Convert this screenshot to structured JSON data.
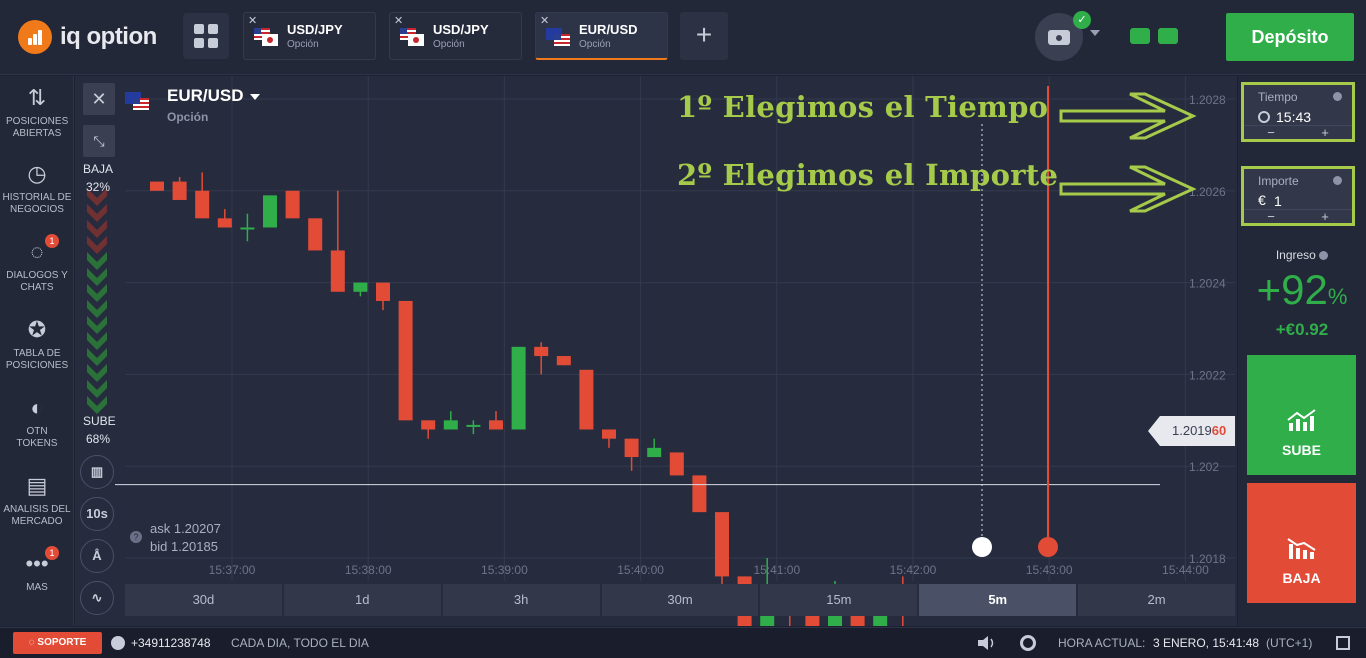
{
  "app": {
    "logo_text": "iq option",
    "deposit_label": "Depósito"
  },
  "tabs": [
    {
      "name": "USD/JPY",
      "type": "Opción",
      "flags": [
        "us",
        "jp"
      ]
    },
    {
      "name": "USD/JPY",
      "type": "Opción",
      "flags": [
        "us",
        "jp"
      ]
    },
    {
      "name": "EUR/USD",
      "type": "Opción",
      "flags": [
        "eu",
        "us"
      ],
      "active": true
    }
  ],
  "sidebar": {
    "items": [
      {
        "icon": "arrows-updown-icon",
        "label": "POSICIONES ABIERTAS"
      },
      {
        "icon": "history-clock-icon",
        "label": "HISTORIAL DE NEGOCIOS"
      },
      {
        "icon": "chat-bubble-icon",
        "label": "DIALOGOS Y CHATS",
        "badge": "1"
      },
      {
        "icon": "medal-icon",
        "label": "TABLA DE POSICIONES"
      },
      {
        "icon": "token-icon",
        "label": "OTN TOKENS"
      },
      {
        "icon": "newspaper-icon",
        "label": "ANALISIS DEL MERCADO"
      },
      {
        "icon": "dots-icon",
        "label": "MAS",
        "badge": "1"
      }
    ]
  },
  "chart": {
    "asset_name": "EUR/USD",
    "asset_type": "Opción",
    "sentiment_down_label": "BAJA",
    "sentiment_down_pct": "32%",
    "sentiment_up_label": "SUBE",
    "sentiment_up_pct": "68%",
    "ask": "ask 1.20207",
    "bid": "bid 1.20185",
    "timeframe_btn": "10s",
    "current_price_main": "1.2019",
    "current_price_tail": "60",
    "annotation_1": "1º Elegimos el Tiempo",
    "annotation_2": "2º Elegimos el Importe",
    "periods": [
      "30d",
      "1d",
      "3h",
      "30m",
      "15m",
      "5m",
      "2m"
    ],
    "active_period": "5m"
  },
  "chart_data": {
    "type": "candlestick",
    "y_ticks": [
      "1.2028",
      "1.2026",
      "1.2024",
      "1.2022",
      "1.202",
      "1.2018"
    ],
    "y_range": [
      1.20175,
      1.20285
    ],
    "x_ticks": [
      "15:37:00",
      "15:38:00",
      "15:39:00",
      "15:40:00",
      "15:41:00",
      "15:42:00",
      "15:43:00",
      "15:44:00"
    ],
    "candles": [
      [
        1.20262,
        1.2026,
        1.20262,
        1.2026
      ],
      [
        1.20262,
        1.20258,
        1.20263,
        1.20258
      ],
      [
        1.2026,
        1.20254,
        1.20264,
        1.20254
      ],
      [
        1.20254,
        1.20252,
        1.20256,
        1.20252
      ],
      [
        1.20252,
        1.20252,
        1.20255,
        1.20249
      ],
      [
        1.20252,
        1.20259,
        1.20259,
        1.20252
      ],
      [
        1.2026,
        1.20254,
        1.2026,
        1.20254
      ],
      [
        1.20254,
        1.20247,
        1.20254,
        1.20247
      ],
      [
        1.20247,
        1.20238,
        1.2026,
        1.20238
      ],
      [
        1.20238,
        1.2024,
        1.2024,
        1.20237
      ],
      [
        1.2024,
        1.20236,
        1.2024,
        1.20234
      ],
      [
        1.20236,
        1.2021,
        1.20236,
        1.2021
      ],
      [
        1.2021,
        1.20208,
        1.2021,
        1.20206
      ],
      [
        1.20208,
        1.2021,
        1.20212,
        1.20208
      ],
      [
        1.20209,
        1.20209,
        1.2021,
        1.20207
      ],
      [
        1.2021,
        1.20208,
        1.20212,
        1.20208
      ],
      [
        1.20208,
        1.20226,
        1.20226,
        1.20208
      ],
      [
        1.20226,
        1.20224,
        1.20227,
        1.2022
      ],
      [
        1.20224,
        1.20222,
        1.20224,
        1.20222
      ],
      [
        1.20221,
        1.20208,
        1.20221,
        1.20208
      ],
      [
        1.20208,
        1.20206,
        1.20208,
        1.20204
      ],
      [
        1.20206,
        1.20202,
        1.20206,
        1.20199
      ],
      [
        1.20202,
        1.20204,
        1.20206,
        1.20202
      ],
      [
        1.20203,
        1.20198,
        1.20203,
        1.20198
      ],
      [
        1.20198,
        1.2019,
        1.20198,
        1.2019
      ],
      [
        1.2019,
        1.20176,
        1.2019,
        1.20172
      ],
      [
        1.20176,
        1.20158,
        1.20176,
        1.2015
      ],
      [
        1.20158,
        1.20174,
        1.2018,
        1.20155
      ],
      [
        1.20174,
        1.2017,
        1.20174,
        1.2016
      ],
      [
        1.2017,
        1.20165,
        1.2017,
        1.20162
      ],
      [
        1.20165,
        1.20173,
        1.20175,
        1.20164
      ],
      [
        1.20173,
        1.20156,
        1.20173,
        1.20156
      ],
      [
        1.20156,
        1.20173,
        1.20173,
        1.2015
      ],
      [
        1.20173,
        1.2017,
        1.20176,
        1.20165
      ]
    ],
    "current_price": 1.20196,
    "up_color": "#2fae4a",
    "down_color": "#e24c37"
  },
  "trade": {
    "time_label": "Tiempo",
    "time_value": "15:43",
    "amount_label": "Importe",
    "amount_value": "1",
    "currency_symbol": "€",
    "minus": "−",
    "plus": "+",
    "income_label": "Ingreso",
    "income_pct": "+92",
    "income_pct_sign": "%",
    "income_value": "+€0.92",
    "up_label": "SUBE",
    "down_label": "BAJA"
  },
  "bottom": {
    "support": "SOPORTE",
    "phone": "+34911238748",
    "hours": "CADA DIA, TODO EL DIA",
    "time_label": "HORA ACTUAL:",
    "time_value": "3 ENERO, 15:41:48",
    "tz": "(UTC+1)"
  },
  "colors": {
    "accent": "#f07a1a",
    "green": "#2fae4a",
    "red": "#e24c37",
    "annotation": "#a6cb4a"
  }
}
